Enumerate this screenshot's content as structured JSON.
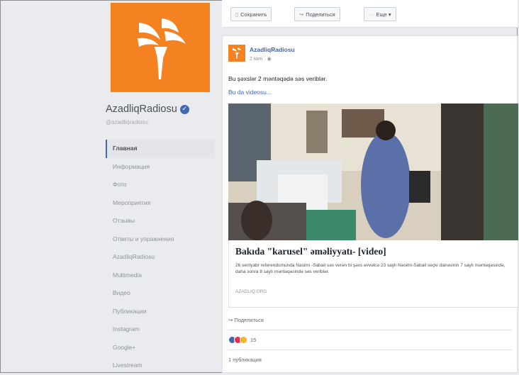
{
  "page": {
    "name": "AzadliqRadiosu",
    "handle": "@azadliqradiosu",
    "brand_color": "#f58220",
    "verified_icon": "check-circle-icon"
  },
  "toolbar": {
    "save_label": "Сохранить",
    "save_icon": "bookmark-icon",
    "share_label": "Поделиться",
    "share_icon": "share-arrow-icon",
    "more_label": "Еще",
    "more_icon": "ellipsis-icon"
  },
  "sidebar": {
    "items": [
      {
        "label": "Главная",
        "active": true
      },
      {
        "label": "Информация"
      },
      {
        "label": "Фото"
      },
      {
        "label": "Мероприятия"
      },
      {
        "label": "Отзывы"
      },
      {
        "label": "Ответы и упражнения"
      },
      {
        "label": "AzadliqRadiosu"
      },
      {
        "label": "Multimedia"
      },
      {
        "label": "Видео"
      },
      {
        "label": "Публикации"
      },
      {
        "label": "Instagram"
      },
      {
        "label": "Google+"
      },
      {
        "label": "Livestream"
      }
    ]
  },
  "post": {
    "author": "AzadliqRadiosu",
    "meta": "2 мин · ◉",
    "text": "Bu şəxslər 2 məntəqədə səs veriblər.",
    "see_more": "Bu da videosu...",
    "link": {
      "title": "Bakıda \"karusel\" əməliyyatı- [video]",
      "description": "26 sentyabr referendumunda Nasimi -Sabail səs verən bi şəxs əvvəlcə 23 saylı Nəsimi-Sabail seçki dairəsinin 7 saylı məntəqəsində, daha sonra 8 saylı məntəqəsində səs veriblər.",
      "domain": "AZADLIQ.ORG"
    },
    "action": "Поделиться",
    "action_icon": "share-arrow-icon",
    "reaction_count": "15",
    "shares": "1 публикация"
  }
}
